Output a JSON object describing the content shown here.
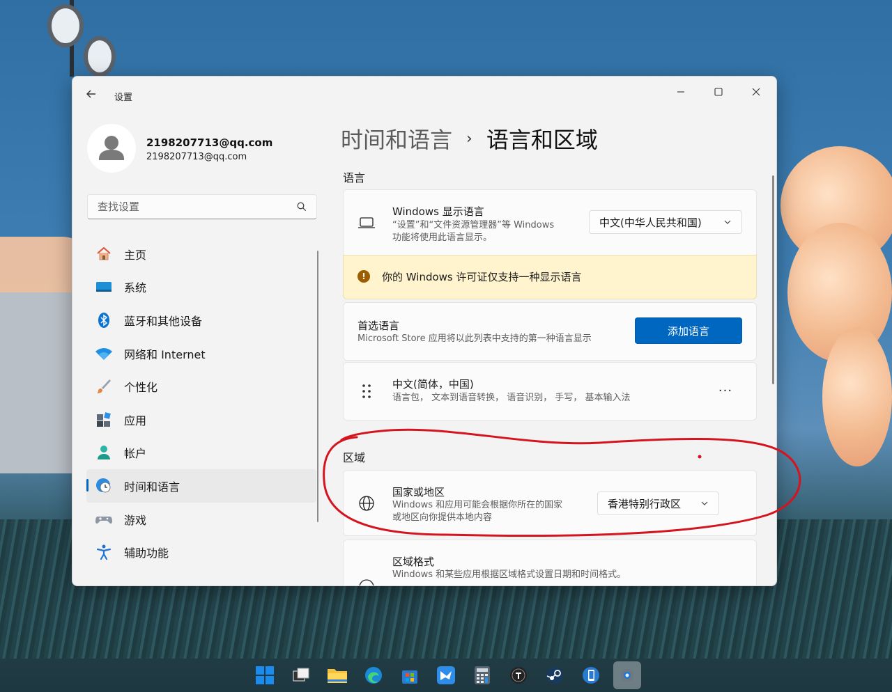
{
  "window": {
    "app_title": "设置"
  },
  "profile": {
    "name": "2198207713@qq.com",
    "email": "2198207713@qq.com"
  },
  "search": {
    "placeholder": "查找设置"
  },
  "sidebar": {
    "items": [
      {
        "label": "主页",
        "icon": "home-icon"
      },
      {
        "label": "系统",
        "icon": "system-icon"
      },
      {
        "label": "蓝牙和其他设备",
        "icon": "bluetooth-icon"
      },
      {
        "label": "网络和 Internet",
        "icon": "wifi-icon"
      },
      {
        "label": "个性化",
        "icon": "brush-icon"
      },
      {
        "label": "应用",
        "icon": "apps-icon"
      },
      {
        "label": "帐户",
        "icon": "account-icon"
      },
      {
        "label": "时间和语言",
        "icon": "time-language-icon",
        "active": true
      },
      {
        "label": "游戏",
        "icon": "gamepad-icon"
      },
      {
        "label": "辅助功能",
        "icon": "accessibility-icon"
      }
    ]
  },
  "breadcrumb": {
    "parent": "时间和语言",
    "separator": "›",
    "current": "语言和区域"
  },
  "language": {
    "section_title": "语言",
    "display_language": {
      "title": "Windows 显示语言",
      "desc_line1": "“设置”和“文件资源管理器”等 Windows",
      "desc_line2": "功能将使用此语言显示。",
      "selected": "中文(中华人民共和国)"
    },
    "warning": "你的 Windows 许可证仅支持一种显示语言",
    "preferred": {
      "title": "首选语言",
      "desc": "Microsoft Store 应用将以此列表中支持的第一种语言显示",
      "add_button": "添加语言"
    },
    "installed": {
      "name": "中文(简体，中国)",
      "features": "语言包，  文本到语音转换，  语音识别，  手写，  基本输入法",
      "more": "···"
    }
  },
  "region": {
    "section_title": "区域",
    "country": {
      "title": "国家或地区",
      "desc_line1": "Windows 和应用可能会根据你所在的国家",
      "desc_line2": "或地区向你提供本地内容",
      "selected": "香港特别行政区"
    },
    "format": {
      "title": "区域格式",
      "desc": "Windows 和某些应用根据区域格式设置日期和时间格式。"
    }
  },
  "colors": {
    "accent": "#0067c0",
    "warning_bg": "#fff4ce",
    "annotation": "#d4141e"
  }
}
